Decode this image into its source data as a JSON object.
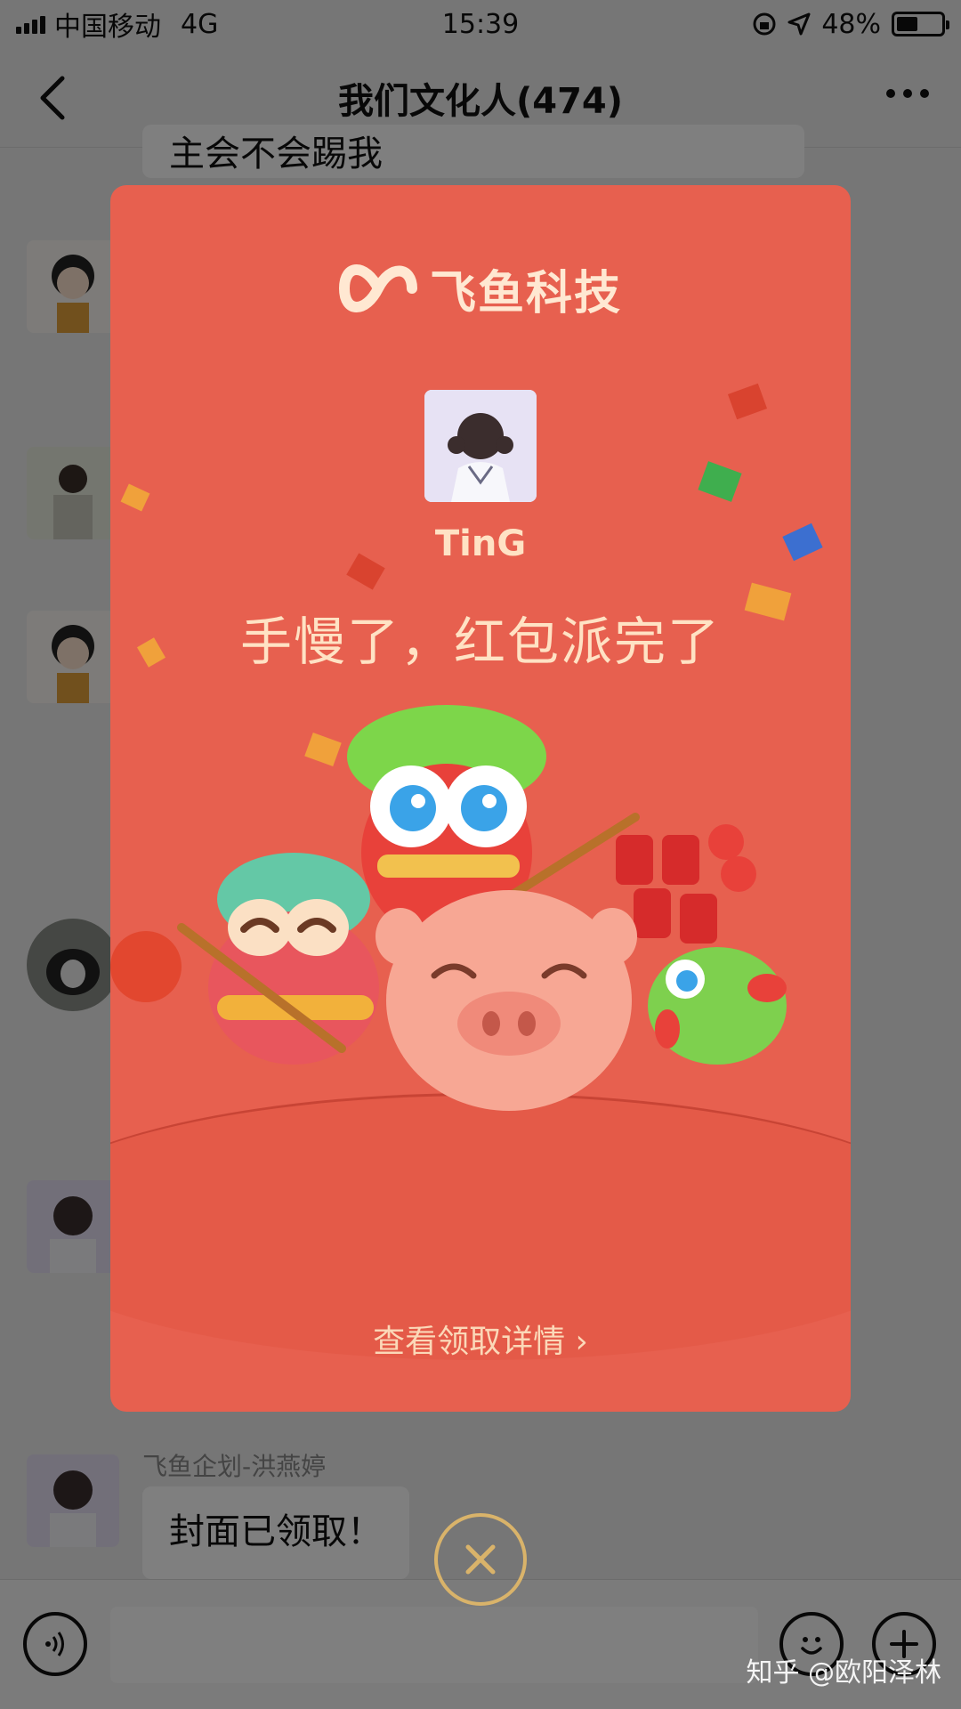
{
  "status_bar": {
    "carrier": "中国移动",
    "network": "4G",
    "time": "15:39",
    "battery": "48%",
    "battery_level": 0.48
  },
  "nav": {
    "title": "我们文化人(474)"
  },
  "chat": {
    "partial_message": "主会不会踢我",
    "last_sender": "飞鱼企划-洪燕婷",
    "last_message": "封面已领取！"
  },
  "red_packet": {
    "brand": "飞鱼科技",
    "sender": "TinG",
    "status": "手慢了，红包派完了",
    "details_link": "查看领取详情 ›",
    "colors": {
      "envelope": "#e7604f",
      "text": "#ffe2c4",
      "close_ring": "#d9b36a"
    }
  },
  "watermark": "知乎 @欧阳泽林",
  "icons": [
    "back-icon",
    "more-icon",
    "voice-icon",
    "emoji-icon",
    "plus-icon",
    "close-icon"
  ]
}
